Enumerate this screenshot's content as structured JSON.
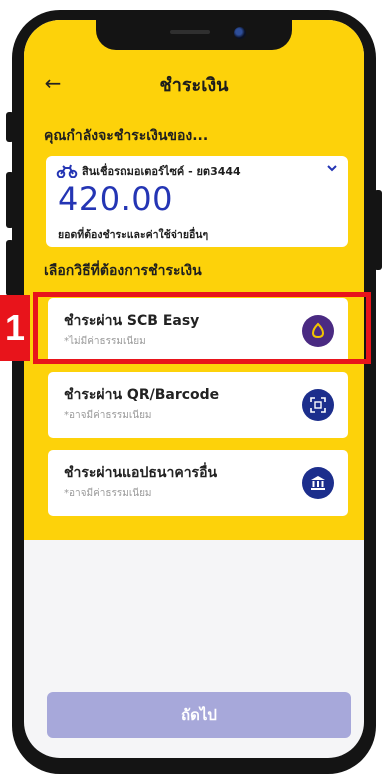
{
  "header": {
    "title": "ชำระเงิน",
    "back_icon": "back-arrow-icon"
  },
  "payment_info": {
    "heading": "คุณกำลังจะชำระเงินของ...",
    "product_label": "สินเชื่อรถมอเตอร์ไซค์ - ยต3444",
    "amount": "420.00",
    "amount_caption": "ยอดที่ต้องชำระและค่าใช้จ่ายอื่นๆ"
  },
  "methods_heading": "เลือกวิธีที่ต้องการชำระเงิน",
  "methods": [
    {
      "title": "ชำระผ่าน SCB Easy",
      "note": "*ไม่มีค่าธรรมเนียม",
      "icon": "scb-easy-icon",
      "icon_color": "#4a2a82"
    },
    {
      "title": "ชำระผ่าน QR/Barcode",
      "note": "*อาจมีค่าธรรมเนียม",
      "icon": "qr-barcode-icon",
      "icon_color": "#1c2e8c"
    },
    {
      "title": "ชำระผ่านแอปธนาคารอื่น",
      "note": "*อาจมีค่าธรรมเนียม",
      "icon": "bank-icon",
      "icon_color": "#1c2e8c"
    }
  ],
  "annotation": {
    "step_number": "1",
    "color": "#e8141b"
  },
  "footer": {
    "next_label": "ถัดไป"
  },
  "colors": {
    "accent_yellow": "#fdd20a",
    "amount_blue": "#2435b4",
    "button_disabled": "#a7a8da"
  }
}
